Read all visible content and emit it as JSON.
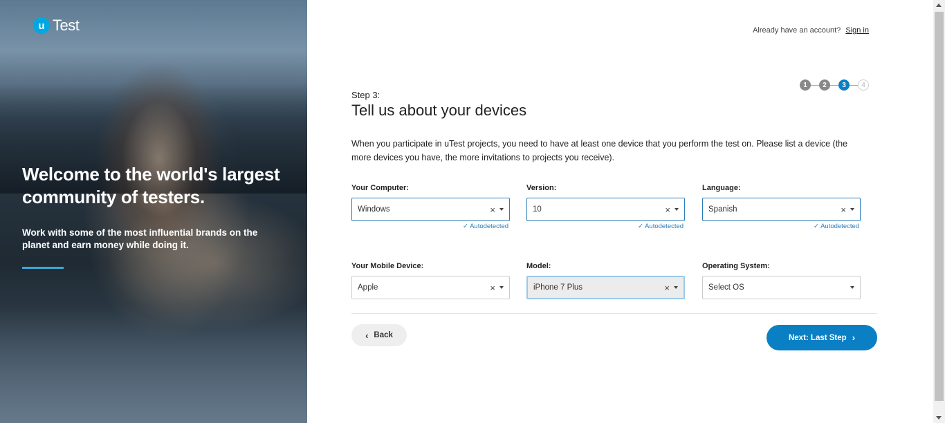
{
  "brand": {
    "logo_letter": "u",
    "logo_text": "Test",
    "accent": "#00a8e1",
    "primary": "#0a7fc4"
  },
  "hero": {
    "title": "Welcome to the world's largest community of testers.",
    "subtitle": "Work with some of the most influential brands on the planet and earn money while doing it."
  },
  "header": {
    "account_prompt": "Already have an account?",
    "sign_in": "Sign in"
  },
  "stepper": {
    "steps": [
      "1",
      "2",
      "3",
      "4"
    ],
    "current": 3
  },
  "step": {
    "label": "Step 3:",
    "title": "Tell us about your devices",
    "description": "When you participate in uTest projects, you need to have at least one device that you perform the test on. Please list a device (the more devices you have, the more invitations to projects you receive)."
  },
  "fields": {
    "computer": {
      "label": "Your Computer:",
      "value": "Windows",
      "note": "✓ Autodetected"
    },
    "version": {
      "label": "Version:",
      "value": "10",
      "note": "✓ Autodetected"
    },
    "language": {
      "label": "Language:",
      "value": "Spanish",
      "note": "✓ Autodetected"
    },
    "mobile_device": {
      "label": "Your Mobile Device:",
      "value": "Apple"
    },
    "model": {
      "label": "Model:",
      "value": "iPhone 7 Plus"
    },
    "os": {
      "label": "Operating System:",
      "placeholder": "Select OS"
    }
  },
  "buttons": {
    "back": "Back",
    "next": "Next: Last Step"
  }
}
